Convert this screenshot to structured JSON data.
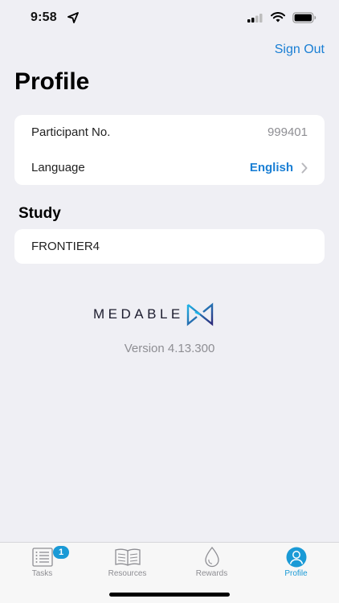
{
  "status_bar": {
    "time": "9:58",
    "icons": [
      "location-arrow-icon",
      "cellular-signal-icon",
      "wifi-icon",
      "battery-icon"
    ]
  },
  "header": {
    "sign_out_label": "Sign Out",
    "title": "Profile"
  },
  "profile": {
    "participant_label": "Participant No.",
    "participant_value": "999401",
    "language_label": "Language",
    "language_value": "English"
  },
  "study": {
    "section_title": "Study",
    "name": "FRONTIER4"
  },
  "branding": {
    "logo_text": "MEDABLE",
    "version": "Version 4.13.300"
  },
  "tabs": [
    {
      "label": "Tasks",
      "icon": "list-icon",
      "badge": "1"
    },
    {
      "label": "Resources",
      "icon": "book-icon"
    },
    {
      "label": "Rewards",
      "icon": "drop-icon"
    },
    {
      "label": "Profile",
      "icon": "person-icon",
      "active": true
    }
  ],
  "colors": {
    "accent": "#1a7fd4",
    "tab_active": "#1a9ad6",
    "background": "#efeff4"
  }
}
